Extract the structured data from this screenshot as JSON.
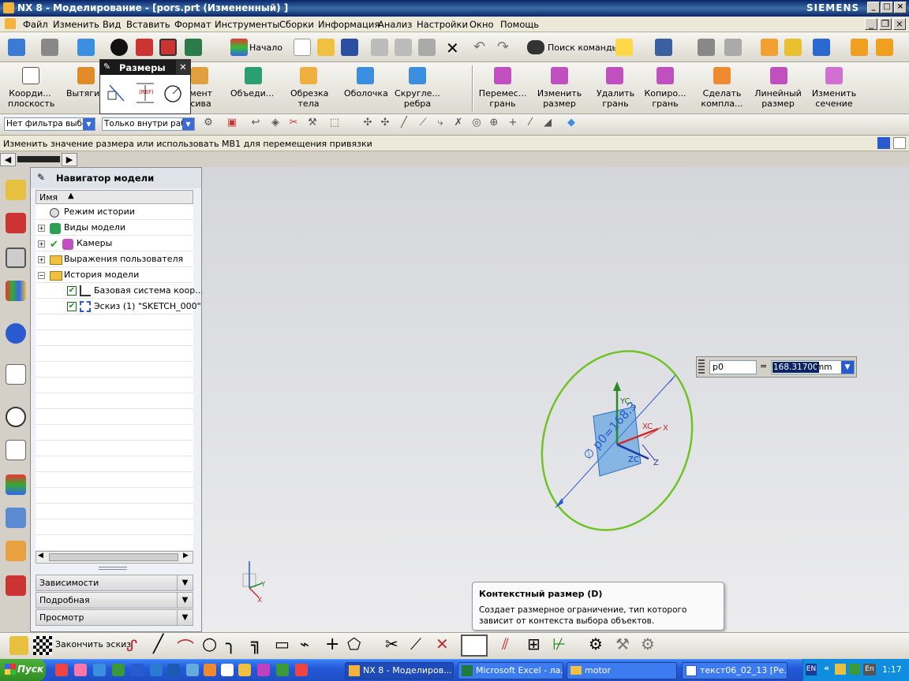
{
  "window": {
    "title": "NX 8 - Моделирование - [pors.prt (Измененный) ]",
    "brand": "SIEMENS",
    "btn_min": "_",
    "btn_max": "□",
    "btn_close": "×",
    "doc_min": "_",
    "doc_restore": "❐",
    "doc_close": "×"
  },
  "menu": [
    "Файл",
    "Изменить",
    "Вид",
    "Вставить",
    "Формат",
    "Инструменты",
    "Сборки",
    "Информация",
    "Анализ",
    "Настройки",
    "Окно",
    "Помощь"
  ],
  "standard_toolbar": {
    "start_label": "Начало",
    "find_command": "Поиск команды"
  },
  "feature_toolbar": {
    "left_buttons": [
      "Коорди...\nплоскость",
      "Вытяги..."
    ],
    "more_buttons": [
      {
        "l1": "Элемент",
        "l2": "массива"
      },
      {
        "l1": "Объеди...",
        "l2": ""
      },
      {
        "l1": "Обрезка",
        "l2": "тела"
      },
      {
        "l1": "Оболочка",
        "l2": ""
      },
      {
        "l1": "Скругле...",
        "l2": "ребра"
      }
    ],
    "sync_buttons": [
      {
        "l1": "Перемес...",
        "l2": "грань"
      },
      {
        "l1": "Изменить",
        "l2": "размер"
      },
      {
        "l1": "Удалить",
        "l2": "грань"
      },
      {
        "l1": "Копиро...",
        "l2": "грань"
      },
      {
        "l1": "Сделать",
        "l2": "компла..."
      },
      {
        "l1": "Линейный",
        "l2": "размер"
      },
      {
        "l1": "Изменить",
        "l2": "сечение"
      }
    ]
  },
  "dimensions_popup": {
    "title": "Размеры",
    "ref_label": "(REF)"
  },
  "selection_bar": {
    "filter": "Нет фильтра выбо",
    "scope": "Только внутри раб"
  },
  "cue_line": "Изменить значение размера или использовать MB1 для перемещения привязки",
  "navigator": {
    "title": "Навигатор модели",
    "column": "Имя",
    "rows": [
      {
        "label": "Режим истории"
      },
      {
        "label": "Виды модели"
      },
      {
        "label": "Камеры"
      },
      {
        "label": "Выражения пользователя"
      },
      {
        "label": "История модели"
      },
      {
        "label": "Базовая система коор..."
      },
      {
        "label": "Эскиз (1) \"SKETCH_000\""
      }
    ],
    "panels": [
      "Зависимости",
      "Подробная",
      "Просмотр"
    ]
  },
  "expression_input": {
    "name": "p0",
    "equals": "=",
    "value": "168.31700",
    "unit": "mm"
  },
  "sketch": {
    "dim_label": "∅ p0=168.3",
    "axis_yc": "YC",
    "axis_xc": "XC",
    "axis_zc": "ZC",
    "axis_x": "X",
    "axis_z": "Z",
    "triad_x": "X",
    "triad_y": "Y"
  },
  "tooltip": {
    "title": "Контекстный размер (D)",
    "body": "Создает размерное ограничение, тип которого зависит от контекста выбора объектов."
  },
  "sketch_toolbar": {
    "finish": "Закончить эскиз"
  },
  "taskbar": {
    "start": "Пуск",
    "tasks": [
      "NX 8 - Моделиров...",
      "Microsoft Excel - ла...",
      "motor",
      "текст06_02_13 [Ре..."
    ],
    "lang": "EN",
    "lang2": "En",
    "time": "1:17"
  },
  "colors": {
    "accent_blue": "#0a246a",
    "sketch_circle": "#6dc424",
    "sketch_plane": "#3a8fe0"
  }
}
